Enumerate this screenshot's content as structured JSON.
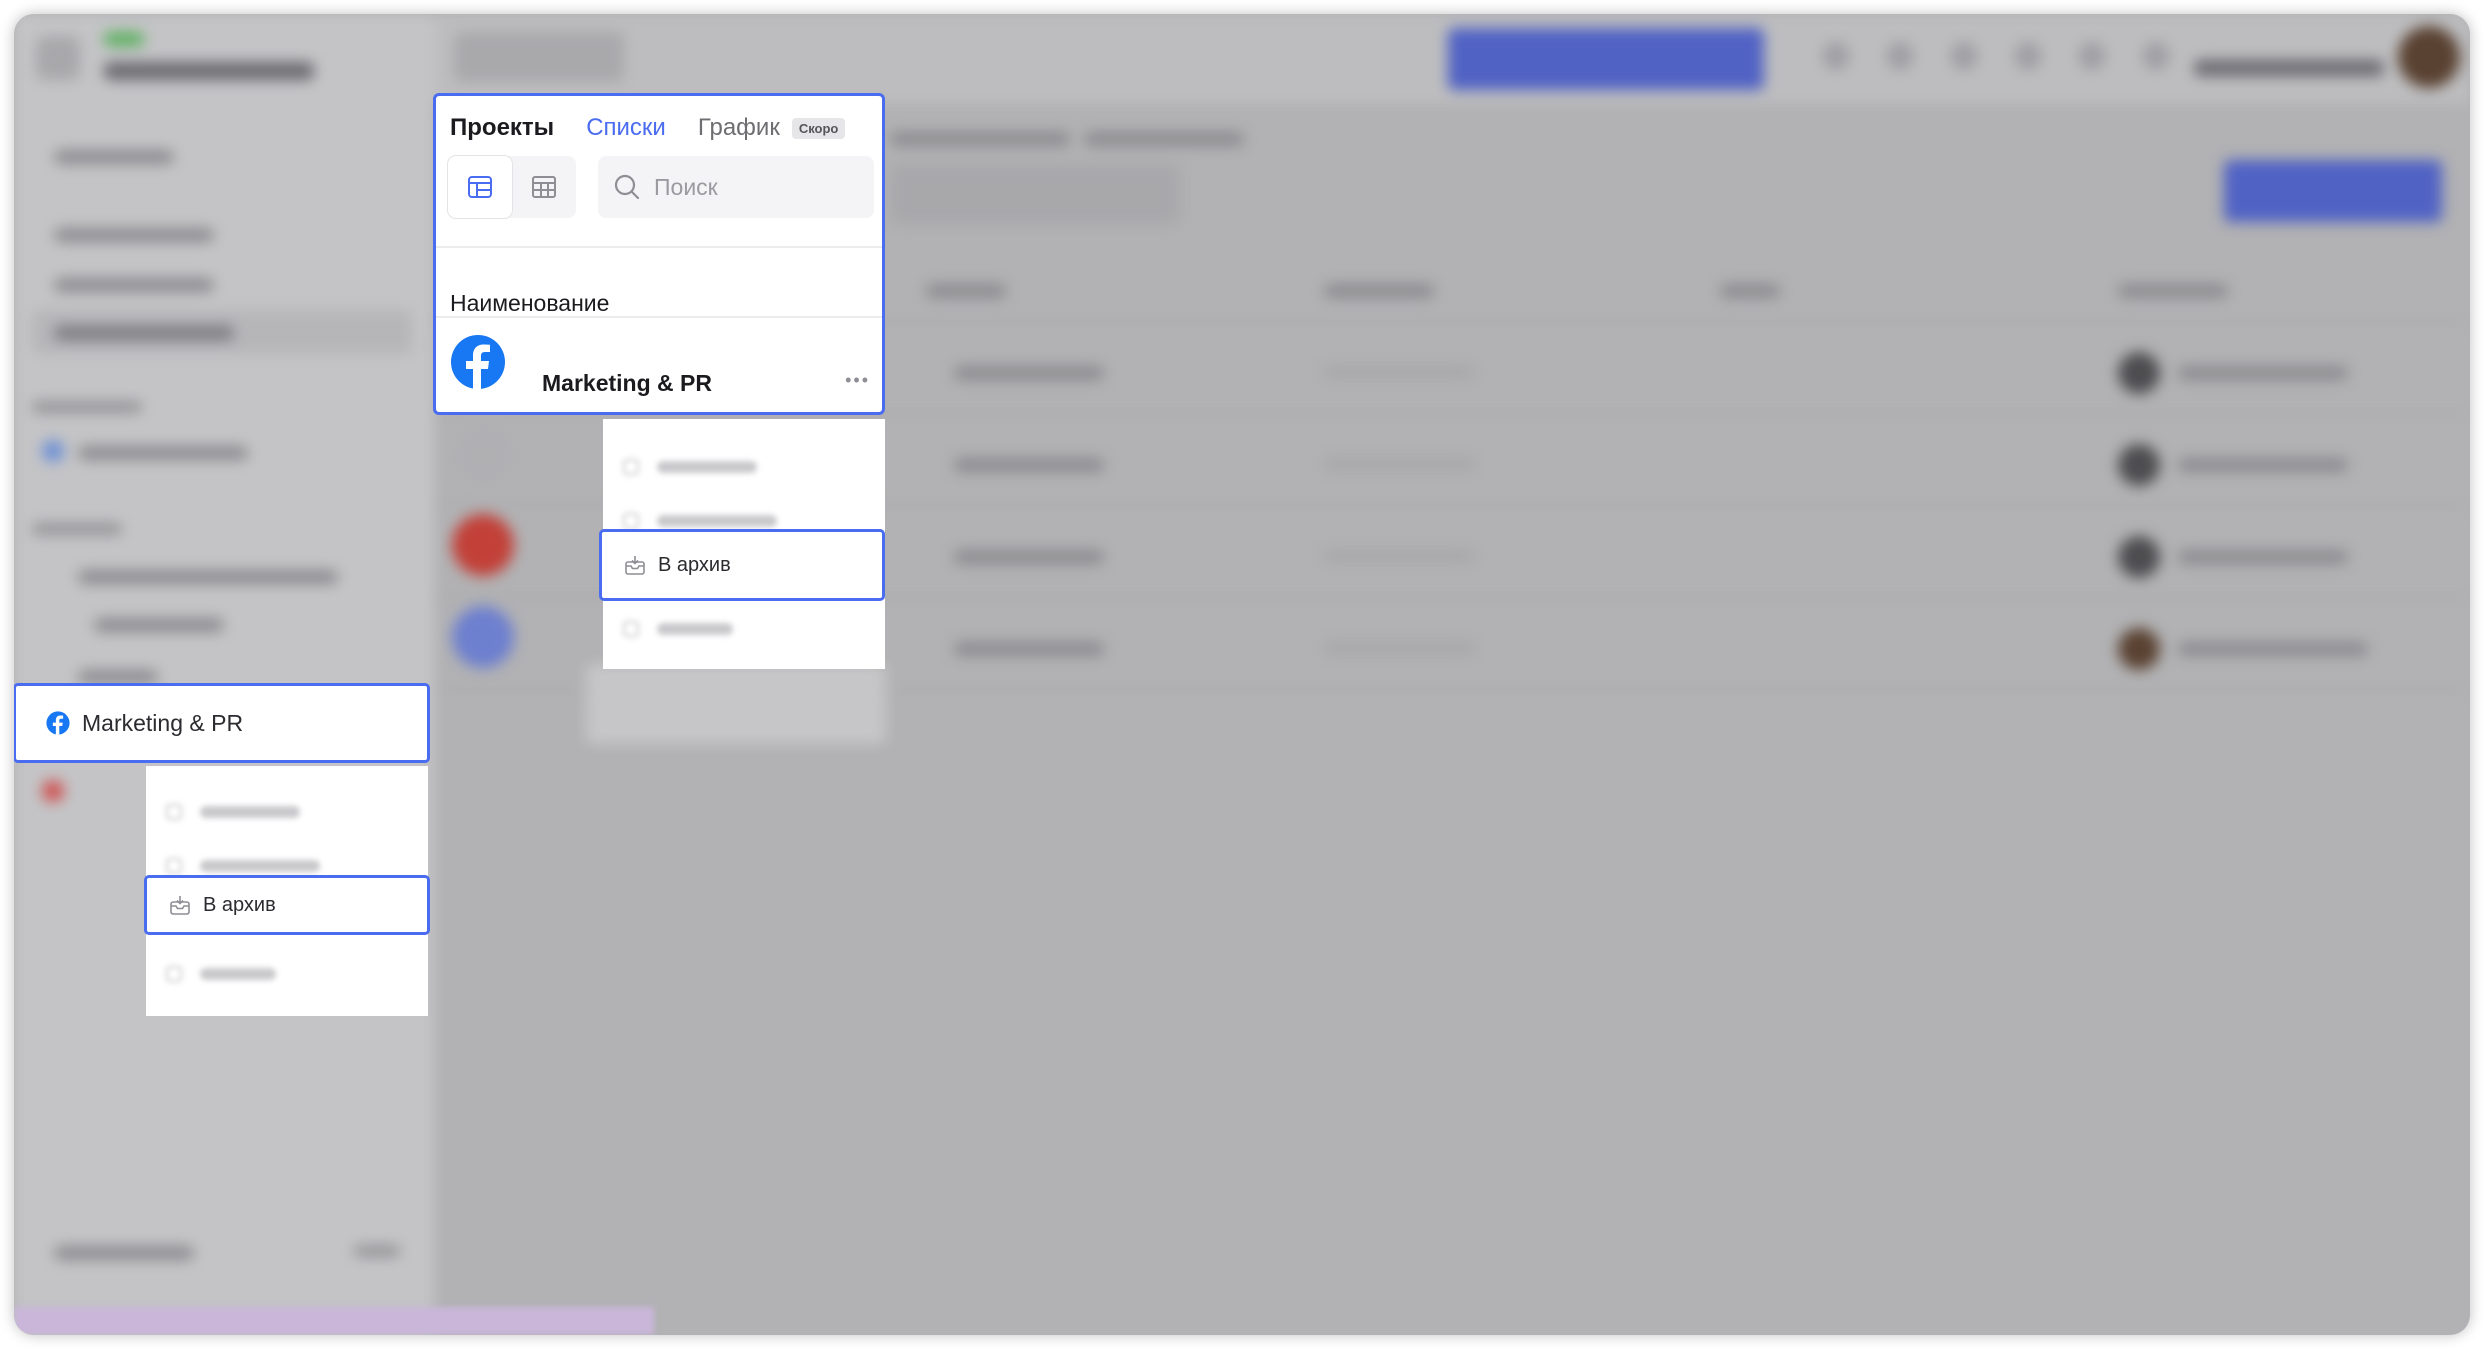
{
  "projects_panel": {
    "tabs": [
      {
        "label": "Проекты",
        "state": "active"
      },
      {
        "label": "Списки",
        "state": "link"
      },
      {
        "label": "График",
        "state": "disabled"
      }
    ],
    "soon_badge": "Скоро",
    "search_placeholder": "Поиск",
    "column_header": "Наименование",
    "row": {
      "name": "Marketing & PR",
      "icon": "facebook-icon"
    }
  },
  "row_context_menu": {
    "highlighted_item": {
      "label": "В архив",
      "icon": "archive-icon"
    }
  },
  "sidebar_highlight": {
    "label": "Marketing & PR",
    "icon": "facebook-icon"
  },
  "sidebar_context_menu": {
    "highlighted_item": {
      "label": "В архив",
      "icon": "archive-icon"
    }
  },
  "colors": {
    "accent": "#4a6cf0",
    "facebook": "#1877f2",
    "backdrop": "#b2b2b4"
  }
}
